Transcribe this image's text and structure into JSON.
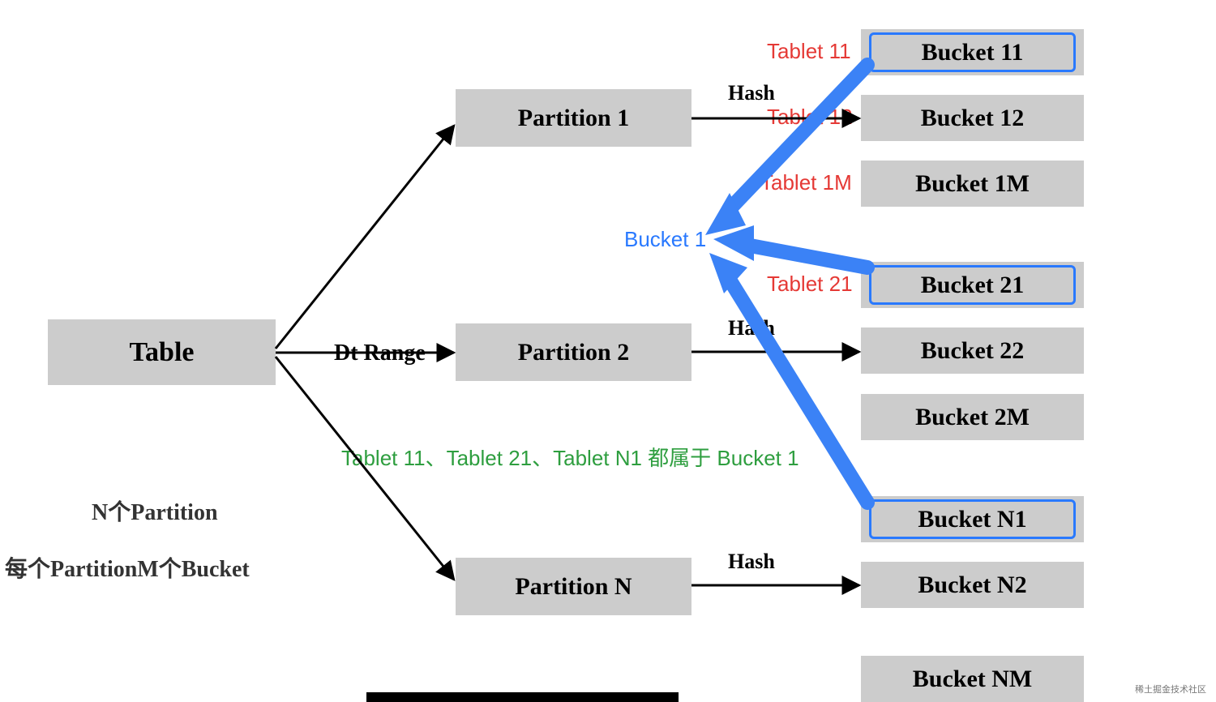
{
  "table": {
    "label": "Table"
  },
  "range_label": "Dt Range",
  "partitions": {
    "p1": {
      "label": "Partition 1"
    },
    "p2": {
      "label": "Partition 2"
    },
    "pN": {
      "label": "Partition N"
    }
  },
  "hash_label": "Hash",
  "buckets": {
    "b11": "Bucket 11",
    "b12": "Bucket 12",
    "b1M": "Bucket 1M",
    "b21": "Bucket 21",
    "b22": "Bucket 22",
    "b2M": "Bucket 2M",
    "bN1": "Bucket N1",
    "bN2": "Bucket N2",
    "bNM": "Bucket NM"
  },
  "tablets": {
    "t11": "Tablet 11",
    "t12": "Tablet 12",
    "t1M": "Tablet 1M",
    "t21": "Tablet 21"
  },
  "converge_label": "Bucket 1",
  "note_green": "Tablet 11、Tablet 21、Tablet N1 都属于 Bucket 1",
  "note_line1": "N个Partition",
  "note_line2": "每个PartitionM个Bucket",
  "watermark": "稀土掘金技术社区"
}
